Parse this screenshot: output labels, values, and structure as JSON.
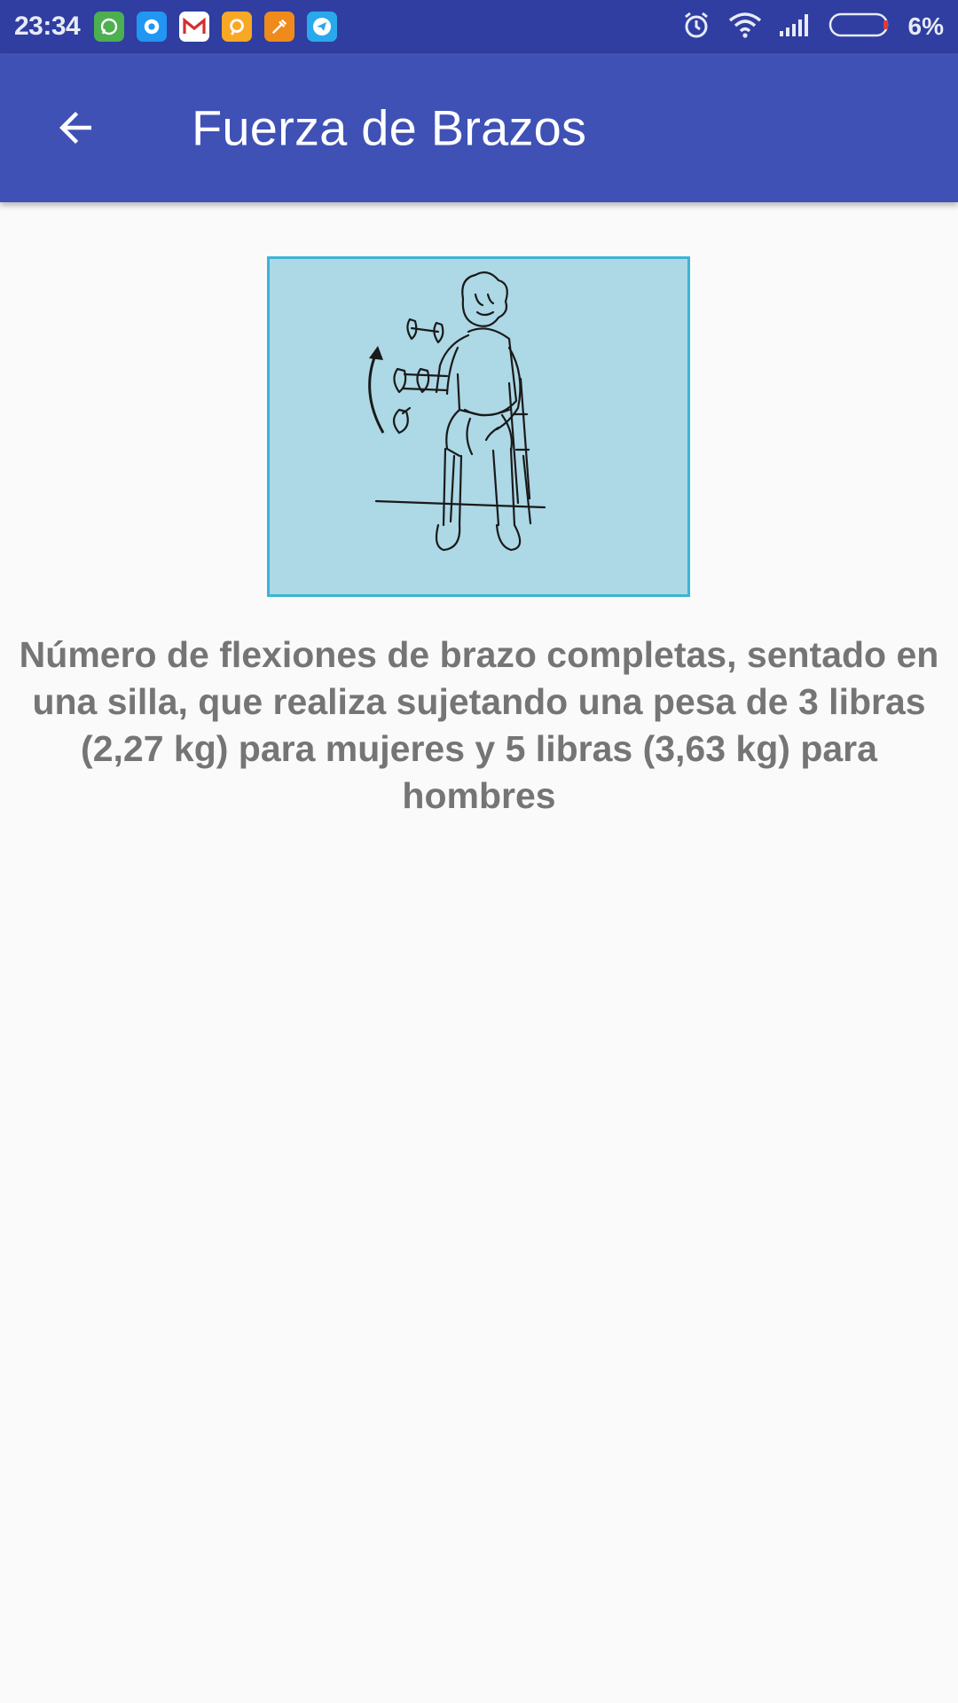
{
  "status_bar": {
    "time": "23:34",
    "notification_icons": [
      {
        "name": "whatsapp-icon",
        "color": "#4caf50"
      },
      {
        "name": "messenger-icon",
        "color": "#2196f3"
      },
      {
        "name": "gmail-icon",
        "color": "#ffffff"
      },
      {
        "name": "chat-app-icon",
        "color": "#f9a825"
      },
      {
        "name": "tool-app-icon",
        "color": "#ef8a1b"
      },
      {
        "name": "telegram-icon",
        "color": "#29a9eb"
      }
    ],
    "battery_percent": "6%",
    "battery_level": 0.06
  },
  "app_bar": {
    "title": "Fuerza de Brazos",
    "accent": "#3f51b5"
  },
  "content": {
    "description": "Número de flexiones de brazo completas, sentado en una silla, que realiza sujetando una pesa de 3 libras (2,27 kg) para mujeres y 5 libras (3,63 kg) para hombres",
    "image_background": "#add8e6"
  }
}
